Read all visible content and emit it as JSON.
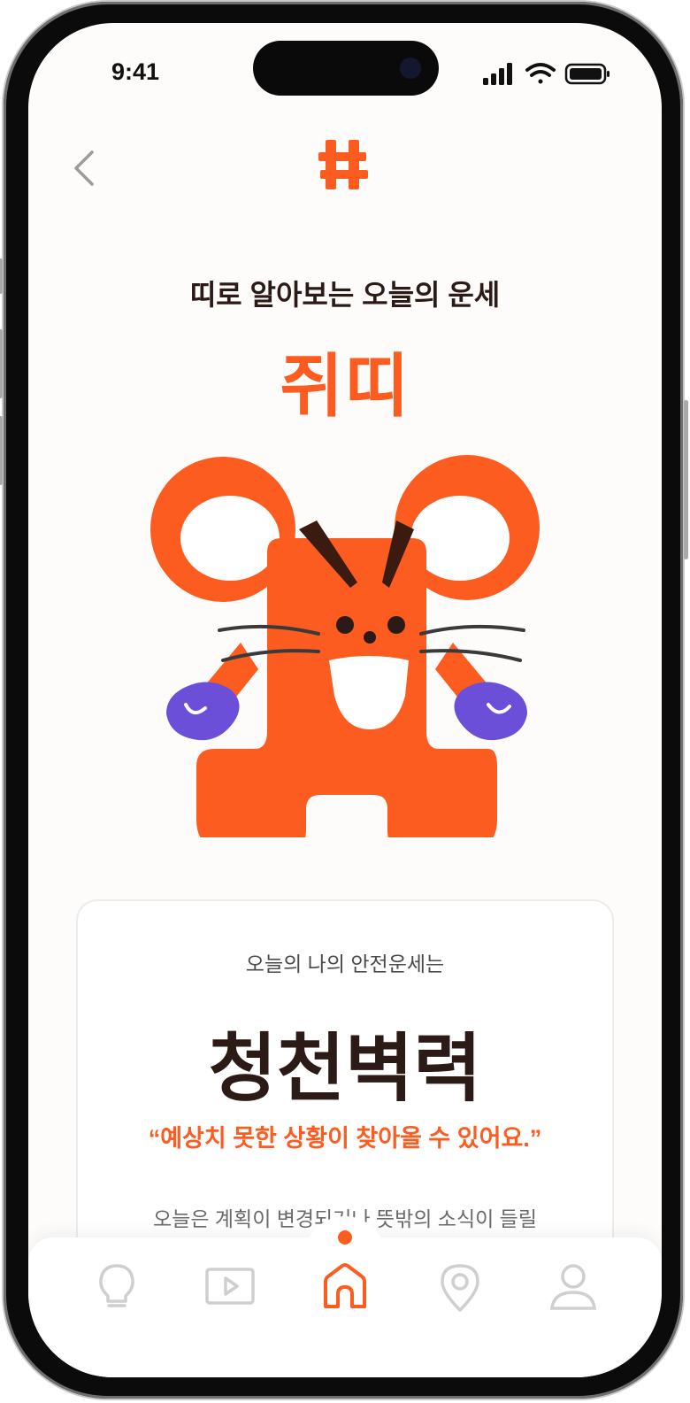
{
  "status_bar": {
    "time": "9:41"
  },
  "header": {
    "back_icon": "chevron-left-icon",
    "logo_icon": "hash-logo-icon"
  },
  "hero": {
    "subtitle": "띠로 알아보는 오늘의 운세",
    "zodiac_name": "쥐띠",
    "mascot": "rat-mascot-illustration"
  },
  "fortune_card": {
    "label": "오늘의 나의 안전운세는",
    "title": "청천벽력",
    "quote": "“예상치 못한 상황이 찾아올 수 있어요.”",
    "body": "오늘은 계획이 변경되거나 뜻밖의 소식이 들릴"
  },
  "tab_bar": {
    "items": [
      {
        "icon": "lightbulb-icon",
        "active": false
      },
      {
        "icon": "video-play-icon",
        "active": false
      },
      {
        "icon": "home-icon",
        "active": true
      },
      {
        "icon": "map-pin-icon",
        "active": false
      },
      {
        "icon": "user-icon",
        "active": false
      }
    ]
  },
  "colors": {
    "accent": "#fc5c20",
    "text_dark": "#2c1a16",
    "mitten": "#6b4fd8",
    "inactive_icon": "#cfcfcf"
  }
}
